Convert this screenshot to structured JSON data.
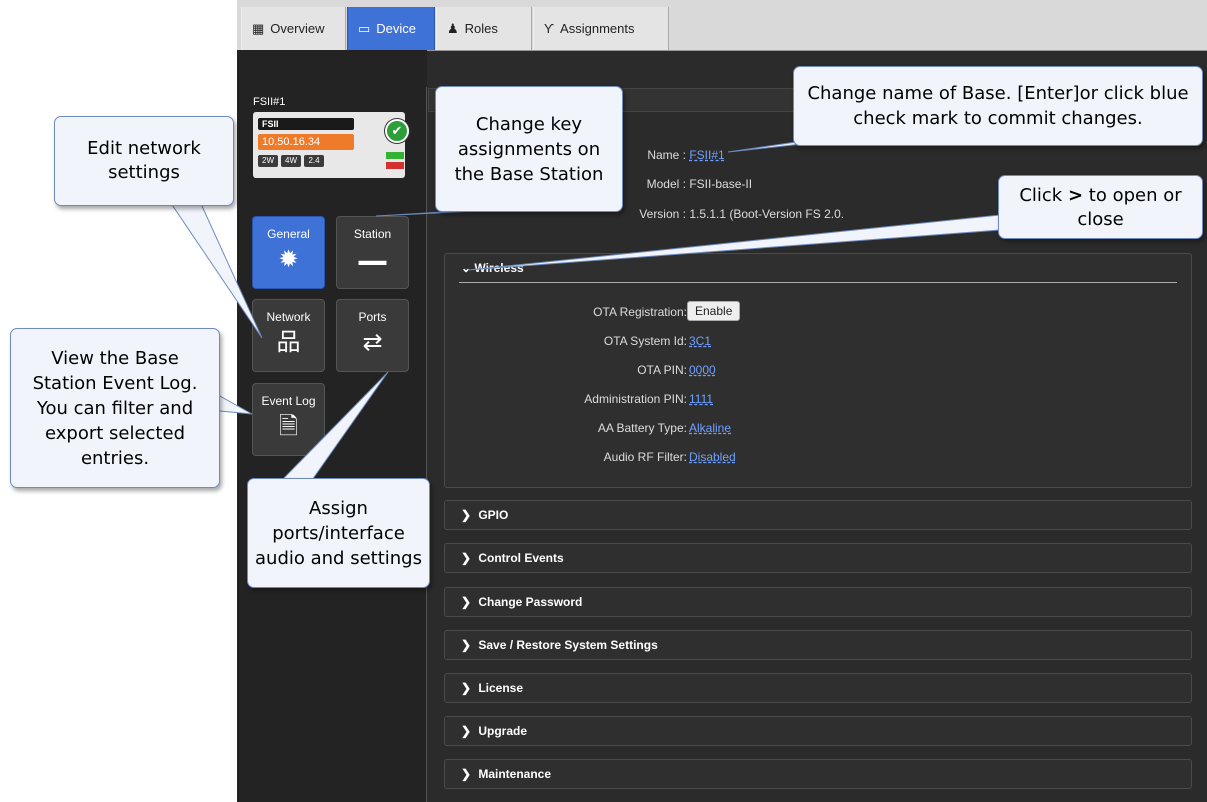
{
  "tabs": [
    {
      "label": "Overview",
      "icon": "grid-icon"
    },
    {
      "label": "Device",
      "icon": "device-icon"
    },
    {
      "label": "Roles",
      "icon": "people-icon"
    },
    {
      "label": "Assignments",
      "icon": "assignments-icon"
    }
  ],
  "device": {
    "label": "FSII#1",
    "card_name": "FSII",
    "ip": "10.50.16.34",
    "chips": [
      "2W",
      "4W",
      "2.4"
    ]
  },
  "tiles": [
    {
      "label": "General",
      "icon": "gear-icon"
    },
    {
      "label": "Station",
      "icon": "station-icon"
    },
    {
      "label": "Network",
      "icon": "network-icon"
    },
    {
      "label": "Ports",
      "icon": "ports-icon"
    },
    {
      "label": "Event Log",
      "icon": "document-icon"
    }
  ],
  "info": {
    "name_label": "Name :",
    "name_value": "FSII#1",
    "model_label": "Model :",
    "model_value": "FSII-base-II",
    "version_label": "Version :",
    "version_value": "1.5.1.1 (Boot-Version FS 2.0."
  },
  "wireless": {
    "title": "Wireless",
    "rows": [
      {
        "label": "OTA Registration:",
        "value": "Enable",
        "kind": "button"
      },
      {
        "label": "OTA System Id:",
        "value": "3C1"
      },
      {
        "label": "OTA PIN:",
        "value": "0000"
      },
      {
        "label": "Administration PIN:",
        "value": "1111"
      },
      {
        "label": "AA Battery Type:",
        "value": "Alkaline"
      },
      {
        "label": "Audio RF Filter:",
        "value": "Disabled"
      }
    ]
  },
  "sections": [
    "GPIO",
    "Control Events",
    "Change Password",
    "Save / Restore System Settings",
    "License",
    "Upgrade",
    "Maintenance"
  ],
  "callouts": {
    "network": "Edit network settings",
    "key": "Change key assignments on the Base Station",
    "name": "Change name of Base. [Enter]or click blue check mark to commit changes.",
    "expand_pre": "Click",
    "expand_symbol": ">",
    "expand_post": "to open or close",
    "eventlog": "View the Base Station Event Log. You can filter and export selected entries.",
    "ports": "Assign ports/interface audio and settings"
  },
  "colors": {
    "accent": "#3f72d6",
    "ip_badge": "#ee7a2a",
    "link": "#6fa0ff",
    "panel": "#2f2f2f"
  }
}
